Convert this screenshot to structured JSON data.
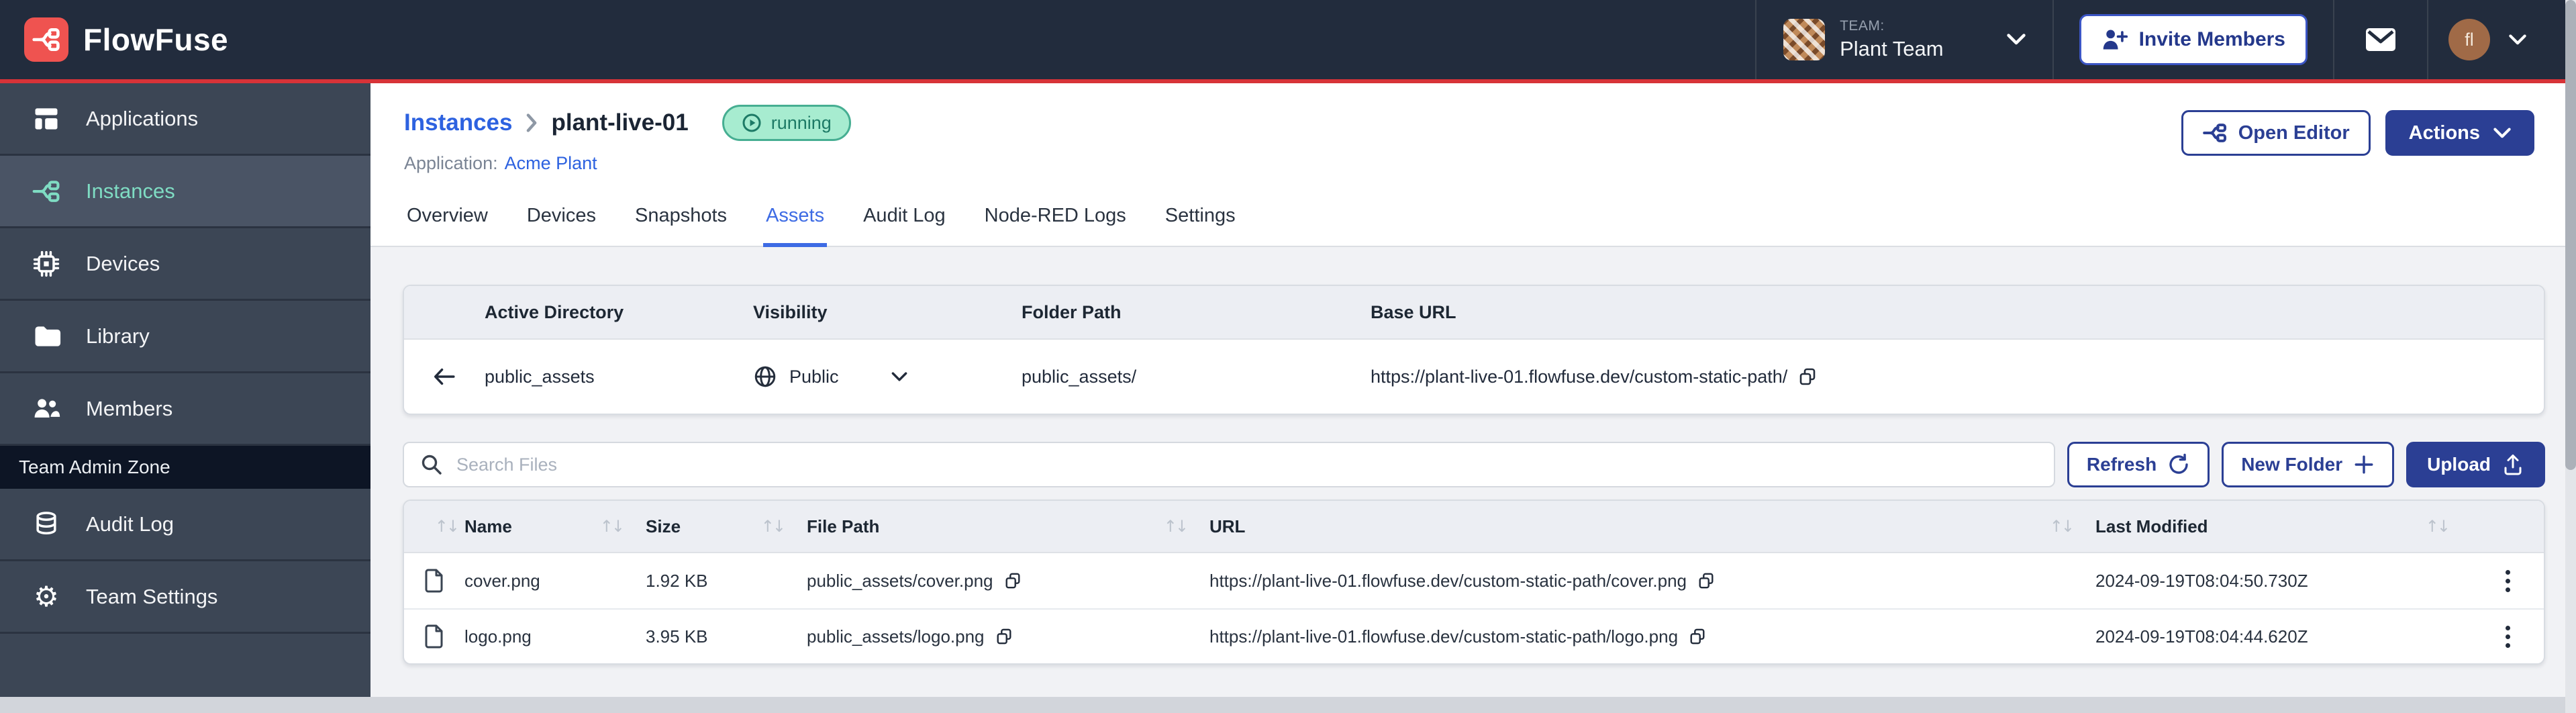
{
  "colors": {
    "topbar_bg": "#222C3D",
    "accent_red_line": "#D73338",
    "brand_red": "#EF5350",
    "accent_indigo": "#2B3F94",
    "link_blue": "#2D62E0",
    "tab_active_blue": "#3D6BE4",
    "sidebar_bg": "#3C4655",
    "sidebar_active_text": "#7FDCC3",
    "badge_green_bg": "#A7ECD0",
    "badge_green_border": "#46AE92",
    "badge_green_text": "#1D7A66"
  },
  "navbar": {
    "brand": "FlowFuse",
    "team_label": "TEAM:",
    "team_name": "Plant Team",
    "invite_label": "Invite Members",
    "avatar_initials": "fl"
  },
  "sidebar": {
    "items": [
      {
        "label": "Applications"
      },
      {
        "label": "Instances"
      },
      {
        "label": "Devices"
      },
      {
        "label": "Library"
      },
      {
        "label": "Members"
      }
    ],
    "admin_zone_label": "Team Admin Zone",
    "admin_items": [
      {
        "label": "Audit Log"
      },
      {
        "label": "Team Settings"
      }
    ]
  },
  "header": {
    "breadcrumb_root": "Instances",
    "instance_name": "plant-live-01",
    "status": "running",
    "application_label": "Application:",
    "application_name": "Acme Plant",
    "open_editor_label": "Open Editor",
    "actions_label": "Actions"
  },
  "tabs": {
    "items": [
      "Overview",
      "Devices",
      "Snapshots",
      "Assets",
      "Audit Log",
      "Node-RED Logs",
      "Settings"
    ],
    "active": "Assets"
  },
  "directory_panel": {
    "columns": [
      "Active Directory",
      "Visibility",
      "Folder Path",
      "Base URL"
    ],
    "row": {
      "name": "public_assets",
      "visibility": "Public",
      "folder_path": "public_assets/",
      "base_url": "https://plant-live-01.flowfuse.dev/custom-static-path/"
    }
  },
  "toolbar": {
    "search_placeholder": "Search Files",
    "refresh_label": "Refresh",
    "new_folder_label": "New Folder",
    "upload_label": "Upload"
  },
  "files_table": {
    "columns": [
      "Name",
      "Size",
      "File Path",
      "URL",
      "Last Modified"
    ],
    "rows": [
      {
        "name": "cover.png",
        "size": "1.92 KB",
        "path": "public_assets/cover.png",
        "url": "https://plant-live-01.flowfuse.dev/custom-static-path/cover.png",
        "modified": "2024-09-19T08:04:50.730Z"
      },
      {
        "name": "logo.png",
        "size": "3.95 KB",
        "path": "public_assets/logo.png",
        "url": "https://plant-live-01.flowfuse.dev/custom-static-path/logo.png",
        "modified": "2024-09-19T08:04:44.620Z"
      }
    ]
  }
}
